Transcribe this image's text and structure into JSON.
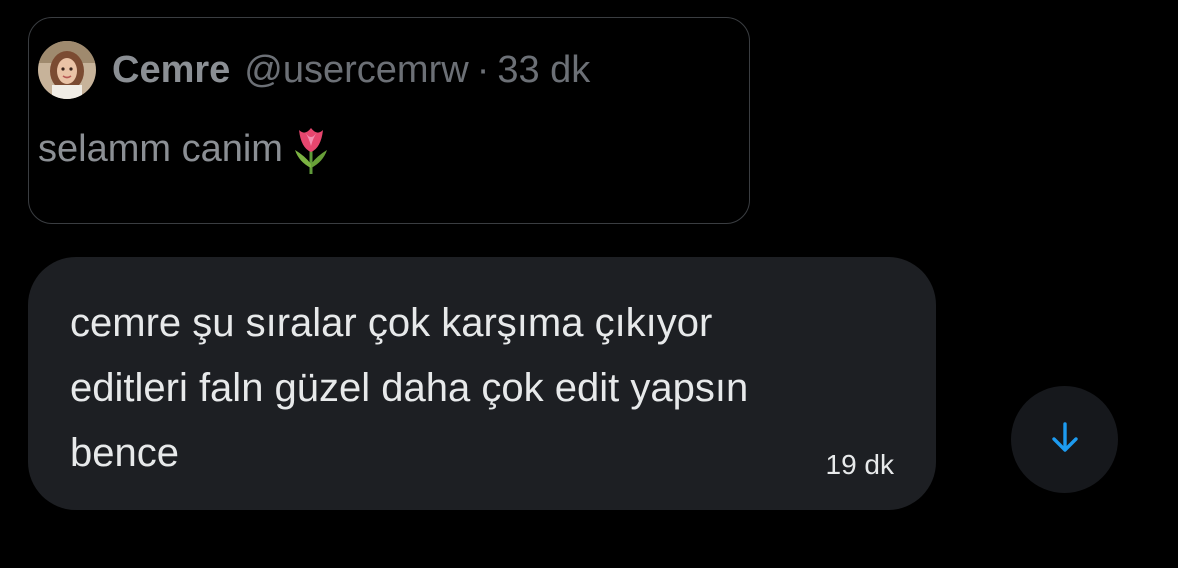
{
  "quoted_post": {
    "author_name": "Cemre",
    "author_handle": "@usercemrw",
    "separator": "·",
    "time": "33 dk",
    "text": "selamm canim",
    "emoji_icon": "tulip-icon"
  },
  "message": {
    "text": "cemre şu sıralar çok karşıma çıkıyor\neditleri faln güzel daha çok edit yapsın\nbence",
    "time": "19 dk"
  },
  "scroll_button": {
    "icon": "arrow-down-icon"
  },
  "colors": {
    "background": "#000000",
    "bubble": "#1d1f23",
    "accent": "#1d9bf0",
    "muted_text": "#6c7076"
  }
}
